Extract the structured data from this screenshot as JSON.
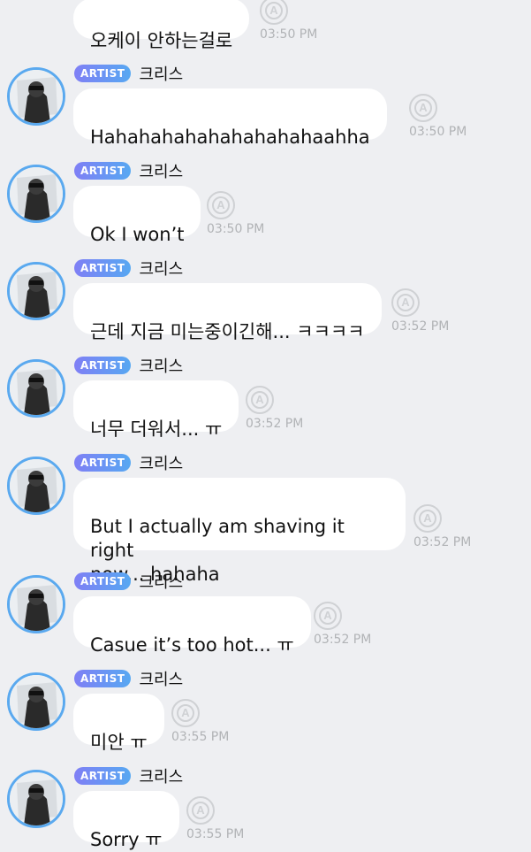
{
  "artist_badge": "ARTIST",
  "sender_name": "크리스",
  "icon_name": "artist-a-icon",
  "messages": [
    {
      "text": "오케이 안하는걸로",
      "time": "03:50 PM",
      "has_header": false
    },
    {
      "text": "Hahahahahahahahahahaahha",
      "time": "03:50 PM",
      "has_header": true
    },
    {
      "text": "Ok I won’t",
      "time": "03:50 PM",
      "has_header": true
    },
    {
      "text": "근데 지금 미는중이긴해... ㅋㅋㅋㅋ",
      "time": "03:52 PM",
      "has_header": true
    },
    {
      "text": "너무 더워서... ㅠ",
      "time": "03:52 PM",
      "has_header": true
    },
    {
      "text": "But I actually am shaving it right\nnow... hahaha",
      "time": "03:52 PM",
      "has_header": true
    },
    {
      "text": "Casue it’s too hot... ㅠ",
      "time": "03:52 PM",
      "has_header": true
    },
    {
      "text": "미안 ㅠ",
      "time": "03:55 PM",
      "has_header": true
    },
    {
      "text": "Sorry ㅠ",
      "time": "03:55 PM",
      "has_header": true
    }
  ]
}
